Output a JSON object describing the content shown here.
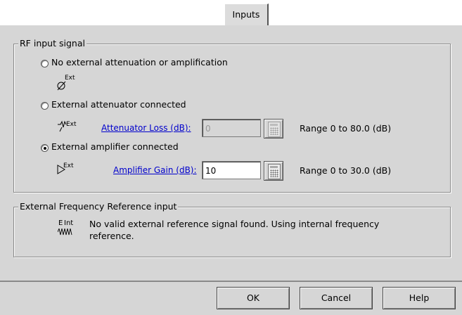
{
  "tab": {
    "label": "Inputs"
  },
  "rf_group": {
    "legend": "RF input signal",
    "options": [
      {
        "label": "No external attenuation or amplification",
        "selected": false,
        "icon_text": "Ext"
      },
      {
        "label": "External attenuator connected",
        "selected": false,
        "icon_text": "Ext",
        "link": "Attenuator Loss (dB):",
        "value": "0",
        "range": "Range 0 to 80.0 (dB)",
        "enabled": false
      },
      {
        "label": "External amplifier connected",
        "selected": true,
        "icon_text": "Ext",
        "link": "Amplifier Gain (dB):",
        "value": "10",
        "range": "Range 0 to 30.0 (dB)",
        "enabled": true
      }
    ]
  },
  "freq_group": {
    "legend": "External Frequency Reference input",
    "icon_text_left": "E",
    "icon_text_right": "Int",
    "message": "No valid external reference signal found. Using internal frequency reference."
  },
  "buttons": {
    "ok": "OK",
    "cancel": "Cancel",
    "help": "Help"
  },
  "colors": {
    "panel": "#d6d6d6",
    "link": "#0000cc"
  }
}
